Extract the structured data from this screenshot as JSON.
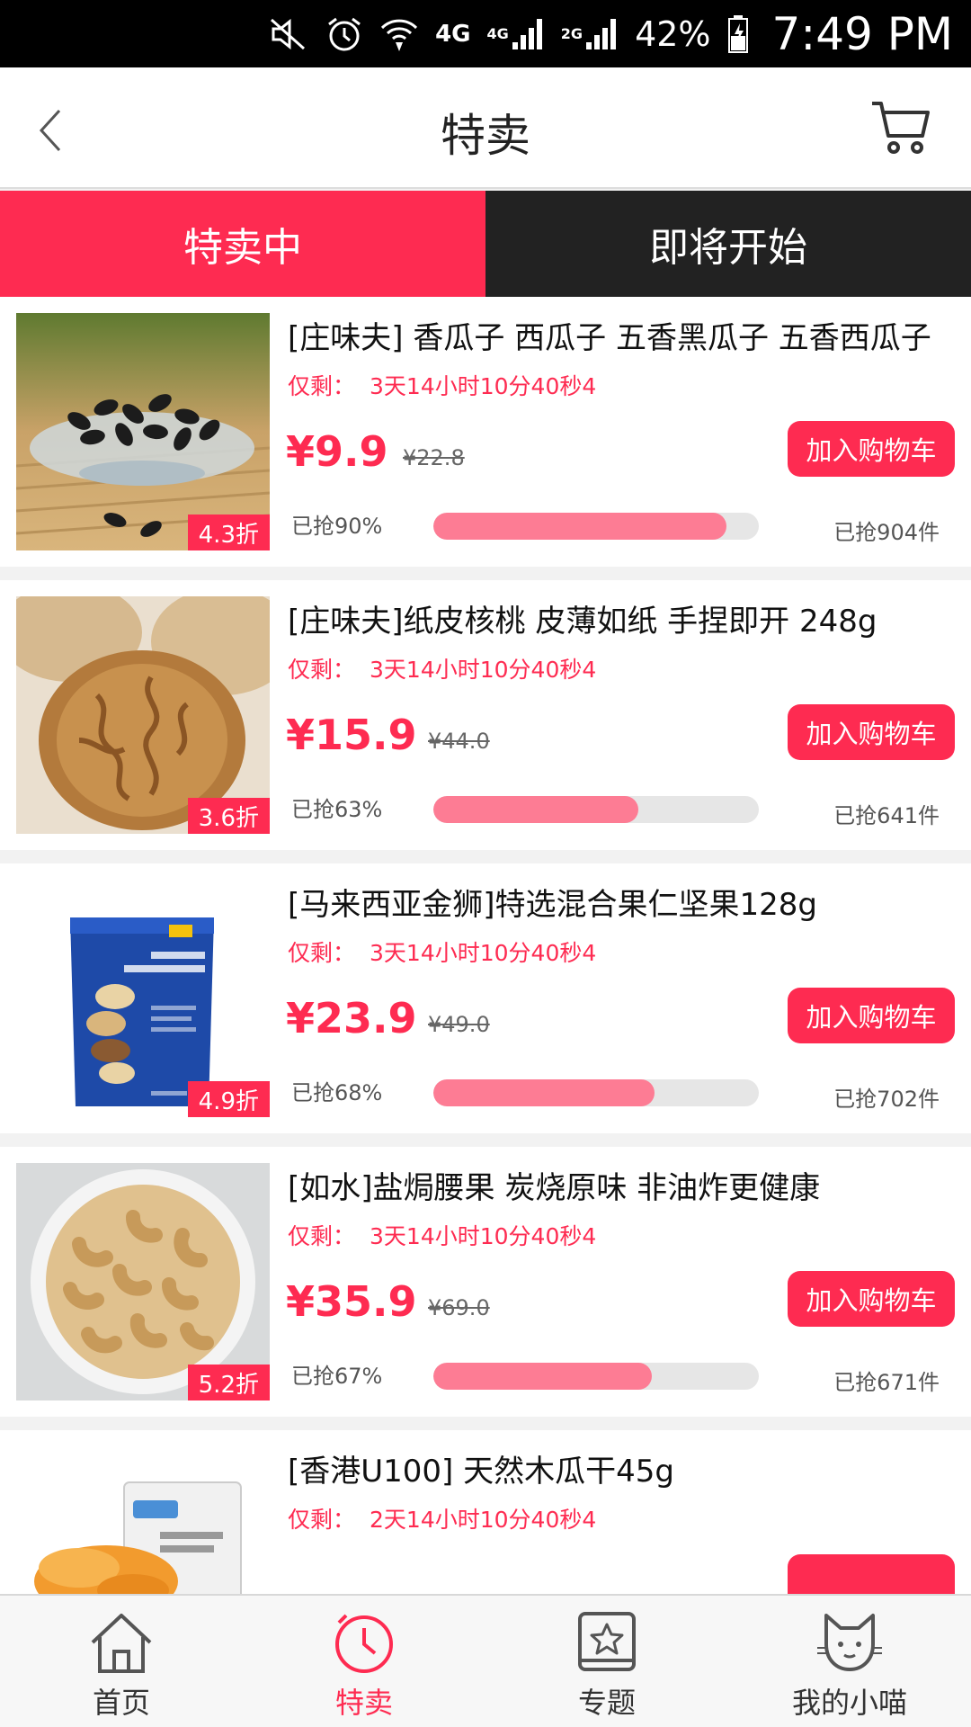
{
  "status_bar": {
    "network_1": "4G",
    "network_2": "4G",
    "network_3": "2G",
    "battery": "42%",
    "time": "7:49 PM"
  },
  "header": {
    "title": "特卖"
  },
  "tabs": [
    {
      "label": "特卖中",
      "active": true
    },
    {
      "label": "即将开始",
      "active": false
    }
  ],
  "products": [
    {
      "name": "[庄味夫] 香瓜子 西瓜子  五香黑瓜子 五香西瓜子",
      "timer_label": "仅剩：",
      "timer_value": "3天14小时10分40秒4",
      "price": "¥9.9",
      "original_price": "¥22.8",
      "discount": "4.3折",
      "add_to_cart": "加入购物车",
      "grabbed_label": "已抢90%",
      "grabbed_percent": 90,
      "sold_label": "已抢904件",
      "image": "watermelon-seeds"
    },
    {
      "name": "[庄味夫]纸皮核桃  皮薄如纸 手捏即开 248g",
      "timer_label": "仅剩：",
      "timer_value": "3天14小时10分40秒4",
      "price": "¥15.9",
      "original_price": "¥44.0",
      "discount": "3.6折",
      "add_to_cart": "加入购物车",
      "grabbed_label": "已抢63%",
      "grabbed_percent": 63,
      "sold_label": "已抢641件",
      "image": "walnut"
    },
    {
      "name": "[马来西亚金狮]特选混合果仁坚果128g",
      "timer_label": "仅剩：",
      "timer_value": "3天14小时10分40秒4",
      "price": "¥23.9",
      "original_price": "¥49.0",
      "discount": "4.9折",
      "add_to_cart": "加入购物车",
      "grabbed_label": "已抢68%",
      "grabbed_percent": 68,
      "sold_label": "已抢702件",
      "image": "mixed-nuts-bag"
    },
    {
      "name": "[如水]盐焗腰果 炭烧原味  非油炸更健康",
      "timer_label": "仅剩：",
      "timer_value": "3天14小时10分40秒4",
      "price": "¥35.9",
      "original_price": "¥69.0",
      "discount": "5.2折",
      "add_to_cart": "加入购物车",
      "grabbed_label": "已抢67%",
      "grabbed_percent": 67,
      "sold_label": "已抢671件",
      "image": "cashews"
    },
    {
      "name": "[香港U100] 天然木瓜干45g",
      "timer_label": "仅剩：",
      "timer_value": "2天14小时10分40秒4",
      "image": "dried-papaya"
    }
  ],
  "bottom_nav": [
    {
      "label": "首页",
      "icon": "home-icon",
      "active": false
    },
    {
      "label": "特卖",
      "icon": "clock-icon",
      "active": true
    },
    {
      "label": "专题",
      "icon": "star-book-icon",
      "active": false
    },
    {
      "label": "我的小喵",
      "icon": "cat-icon",
      "active": false
    }
  ],
  "colors": {
    "accent": "#fe2b51",
    "progress_fill": "#fd7c94",
    "dark_tab": "#222222"
  }
}
